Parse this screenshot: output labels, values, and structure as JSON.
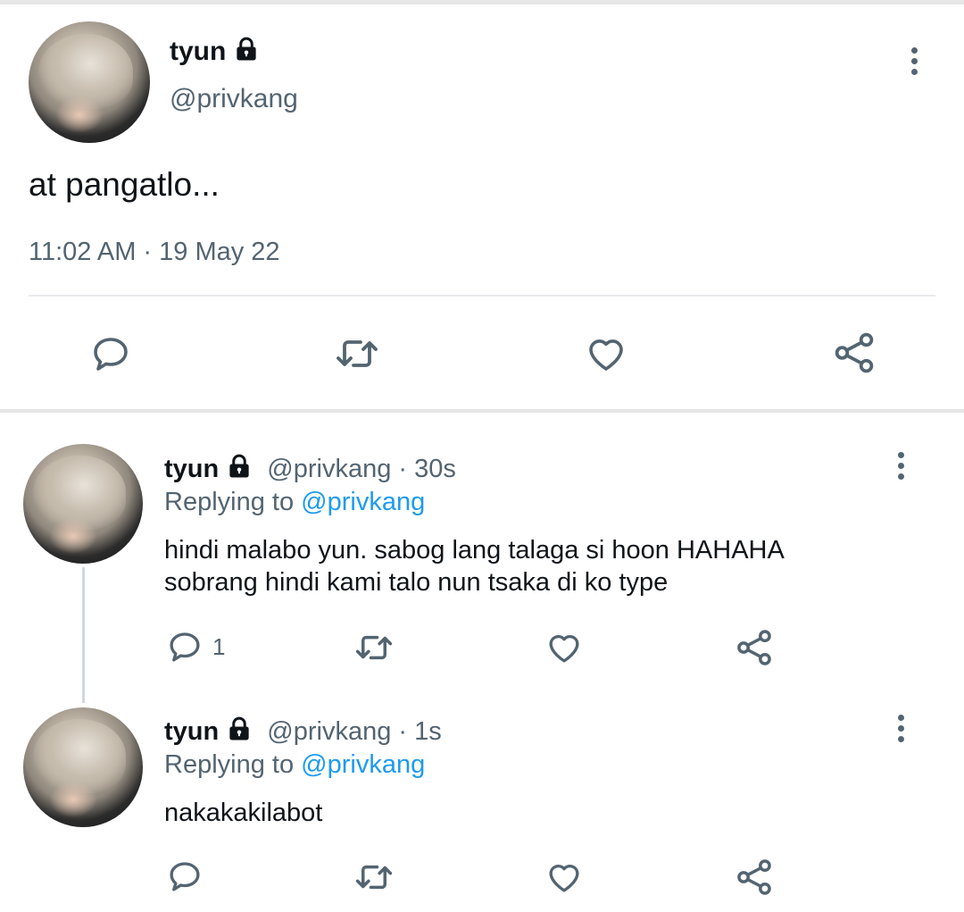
{
  "main_tweet": {
    "display_name": "tyun",
    "handle": "@privkang",
    "text": "at pangatlo...",
    "timestamp": "11:02 AM · 19 May 22",
    "actions": [
      "reply-icon",
      "retweet-icon",
      "like-icon",
      "share-icon"
    ]
  },
  "replies": [
    {
      "display_name": "tyun",
      "handle": "@privkang",
      "time": "· 30s",
      "replying_prefix": "Replying to ",
      "replying_to": "@privkang",
      "line1": "hindi malabo yun. sabog lang talaga si hoon HAHAHA",
      "line2": "sobrang hindi kami talo nun tsaka di ko type",
      "reply_count": "1"
    },
    {
      "display_name": "tyun",
      "handle": "@privkang",
      "time": "· 1s",
      "replying_prefix": "Replying to ",
      "replying_to": "@privkang",
      "line1": "nakakakilabot",
      "reply_count": ""
    }
  ],
  "colors": {
    "text": "#0f1419",
    "secondary": "#536471",
    "link": "#1d9bf0",
    "divider": "#e8eaec"
  }
}
